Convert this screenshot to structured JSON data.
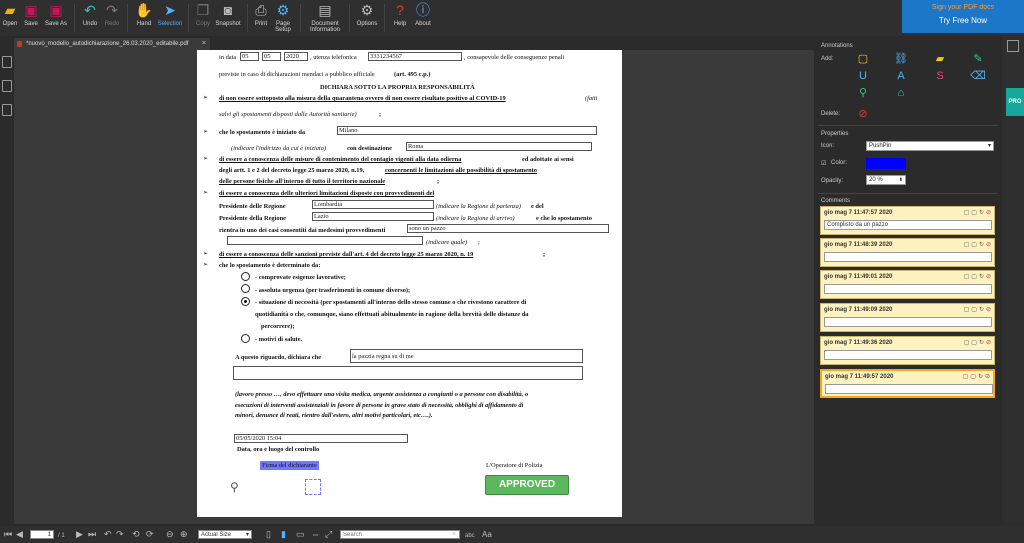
{
  "toolbar": {
    "open": "Open",
    "save": "Save",
    "save_as": "Save As",
    "undo": "Undo",
    "redo": "Redo",
    "hand": "Hand",
    "selection": "Selection",
    "copy": "Copy",
    "snapshot": "Snapshot",
    "print": "Print",
    "page_setup_1": "Page",
    "page_setup_2": "Setup",
    "doc_info_1": "Document",
    "doc_info_2": "Information",
    "options": "Options",
    "help": "Help",
    "about": "About"
  },
  "promo": {
    "line1": "Sign your PDF docs",
    "line2": "Try Free Now"
  },
  "tab": {
    "title": "*nuovo_modello_autodichiarazione_26.03.2020_editabile.pdf",
    "close": "×"
  },
  "document": {
    "l_indata": "in data",
    "f_day": "05",
    "f_month": "05",
    "f_year": "2020",
    "l_utenza": ", utenza telefonica",
    "f_phone": "3331234567",
    "l_consapevole": ", consapevole delle conseguenze penali",
    "l_previste": "previste in caso di dichiarazioni mendaci a pubblico ufficiale",
    "l_art495": "(art. 495 c.p.)",
    "title": "DICHIARA SOTTO LA PROPRIA RESPONSABILITÀ",
    "p1a": "di non essere sottoposto alla misura della quarantena ovvero di non essere risultato positivo al COVID-19",
    "p1b": "(fatti",
    "p1c": "salvi gli spostamenti disposti dalle Autorità sanitarie)",
    "p1d": ";",
    "p2a": "che lo spostamento è iniziato da",
    "f_from": "Milano",
    "p2b": "(indicare l'indirizzo da cui è iniziato)",
    "p2c": "con destinazione",
    "f_to": "Roma",
    "p3a": "di essere a conoscenza delle misure di contenimento del contagio vigenti alla data odierna",
    "p3b": "ed adottate ai sensi",
    "p3c": "degli artt. 1 e 2 del decreto legge 25 marzo 2020, n.19,",
    "p3d": "concernenti le limitazioni alle possibilità di spostamento",
    "p3e": "delle persone fisiche all'interno di tutto il territorio nazionale",
    "p3f": ";",
    "p4a": "di essere a conoscenza delle ulteriori limitazioni disposte con provvedimenti del",
    "p4b": "Presidente delle Regione",
    "f_reg1": "Lombardia",
    "p4c": "(indicare la Regione di partenza)",
    "p4d": "e del",
    "p4e": "Presidente della Regione",
    "f_reg2": "Lazio",
    "p4f": "(indicare la Regione di arrivo)",
    "p4g": "e che lo spostamento",
    "p4h": "rientra in uno dei casi consentiti dai medesimi provvedimenti",
    "f_case": "sono un pazzo",
    "p4i": "(indicare quale)",
    "p4j": ";",
    "p5a": "di essere a conoscenza delle sanzioni previste dall'art. 4 del decreto legge 25 marzo 2020, n. 19",
    "p5b": ";",
    "p6": "che lo spostamento è determinato da:",
    "r1": "- comprovate esigenze lavorative;",
    "r2": "- assoluta urgenza (per trasferimenti in comune diverso);",
    "r3a": "- situazione di necessità (per spostamenti all'interno dello stesso comune o che rivestono carattere di",
    "r3b": "quotidianità o che, comunque, siano effettuati abitualmente in ragione della brevità delle distanze da",
    "r3c": "percorrere);",
    "r4": "- motivi di salute.",
    "p7": "A  questo  riguardo,  dichiara che",
    "f_decl": "la pazzia regna su di me",
    "n1": "(lavoro presso …, devo effettuare una visita medica, urgente assistenza a congiunti o a persone con disabilità, o",
    "n2": "esecuzioni di interventi assistenziali in favore di persone in grave stato di necessità, obblighi di affidamento di",
    "n3": "minori, denunce di reati, rientro dall'estero, altri motivi particolari, etc….).",
    "f_datetime": "05/05/2020 15:04",
    "l_dataora": "Data, ora e luogo del controllo",
    "l_firma": "Firma del dichiarante",
    "l_operatore": "L'Operatore di Polizia",
    "stamp": "APPROVED"
  },
  "annotations_panel": {
    "title": "Annotations",
    "add": "Add:",
    "delete": "Delete:",
    "properties": "Properties",
    "icon_label": "Icon:",
    "icon_value": "PushPin",
    "color_label": "Color:",
    "color_value": "#0000ff",
    "opacity_label": "Opacity:",
    "opacity_value": "20 %",
    "comments": "Comments"
  },
  "comments": [
    {
      "ts": "gio mag 7 11:47:57 2020",
      "text": "Complisto da un pazzo"
    },
    {
      "ts": "gio mag 7 11:48:39 2020",
      "text": ""
    },
    {
      "ts": "gio mag 7 11:49:01 2020",
      "text": ""
    },
    {
      "ts": "gio mag 7 11:49:09 2020",
      "text": ""
    },
    {
      "ts": "gio mag 7 11:49:36 2020",
      "text": ""
    },
    {
      "ts": "gio mag 7 11:49:57 2020",
      "text": ""
    }
  ],
  "side": {
    "pro": "PRO"
  },
  "statusbar": {
    "page_current": "1",
    "page_sep": "/ 1",
    "zoom": "Actual Size",
    "search_placeholder": "Search",
    "abc": "abc",
    "aa": "Aa"
  },
  "colors": {
    "accent": "#1c77c9",
    "promo_text": "#ff9a2e",
    "pro": "#16a79b",
    "stamp": "#5cb85c"
  }
}
